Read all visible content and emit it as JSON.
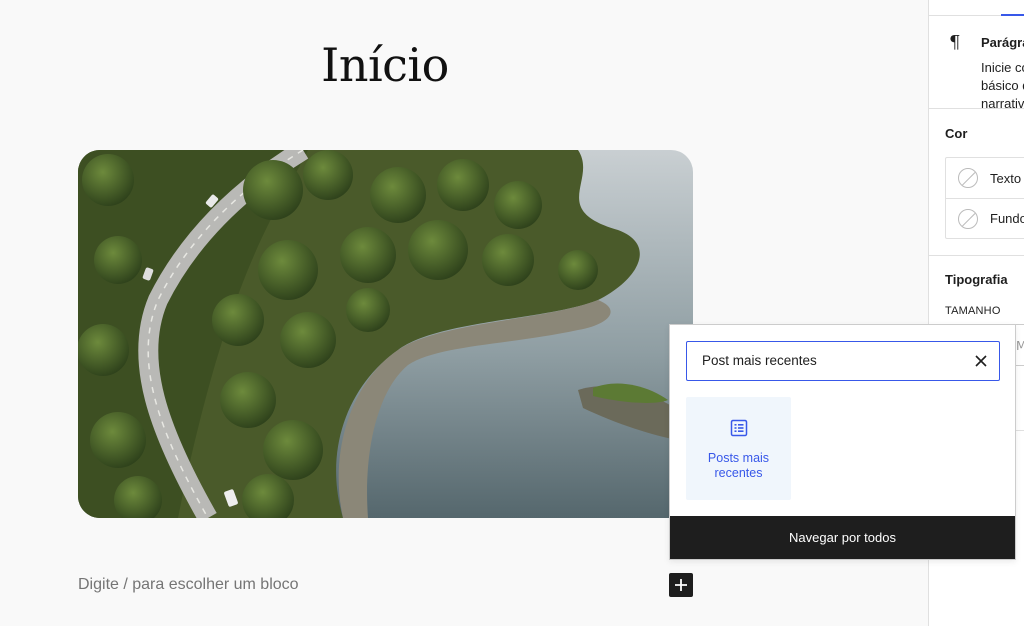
{
  "editor": {
    "page_title": "Início",
    "block_placeholder": "Digite / para escolher um bloco"
  },
  "inserter": {
    "search_value": "Post mais recentes",
    "results": [
      {
        "label": "Posts mais recentes",
        "icon": "list-view-icon"
      }
    ],
    "browse_all_label": "Navegar por todos"
  },
  "sidebar": {
    "block_name": "Parágrafo",
    "block_description": "Inicie com o bloco básico de toda narrativa.",
    "color_title": "Cor",
    "color_items": [
      "Texto",
      "Fundo"
    ],
    "typography_title": "Tipografia",
    "size_label": "TAMANHO"
  },
  "colors": {
    "accent": "#3858e9",
    "dark": "#1e1e1e",
    "canvas_bg": "#f9f9f9"
  }
}
